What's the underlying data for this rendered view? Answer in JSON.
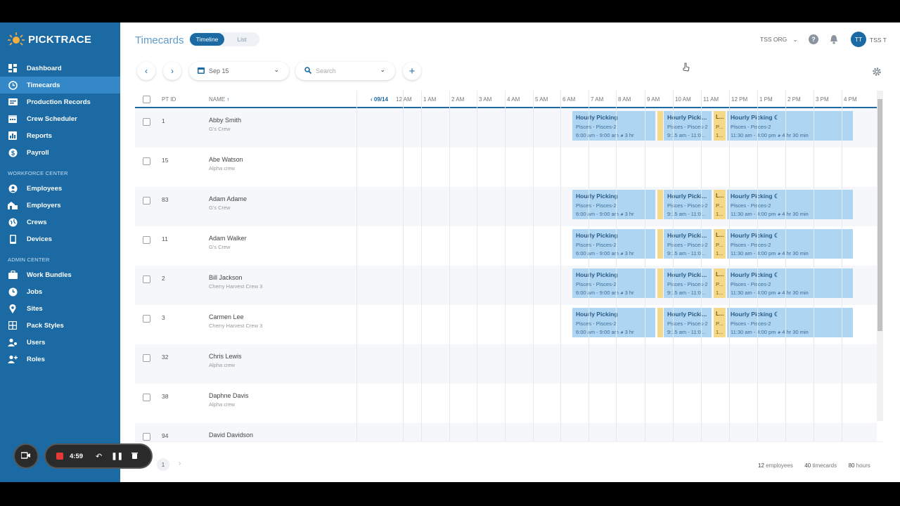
{
  "app": {
    "logo_text": "PICKTRACE"
  },
  "sidebar": {
    "items": [
      {
        "label": "Dashboard",
        "icon": "dashboard-icon"
      },
      {
        "label": "Timecards",
        "icon": "timecards-icon"
      },
      {
        "label": "Production Records",
        "icon": "production-records-icon"
      },
      {
        "label": "Crew Scheduler",
        "icon": "calendar-icon"
      },
      {
        "label": "Reports",
        "icon": "reports-icon"
      },
      {
        "label": "Payroll",
        "icon": "dollar-icon"
      }
    ],
    "workforce_label": "WORKFORCE CENTER",
    "workforce_items": [
      {
        "label": "Employees",
        "icon": "person-icon"
      },
      {
        "label": "Employers",
        "icon": "buildings-icon"
      },
      {
        "label": "Crews",
        "icon": "globe-icon"
      },
      {
        "label": "Devices",
        "icon": "phone-icon"
      }
    ],
    "admin_label": "ADMIN CENTER",
    "admin_items": [
      {
        "label": "Work Bundles",
        "icon": "briefcase-icon"
      },
      {
        "label": "Jobs",
        "icon": "clock-icon"
      },
      {
        "label": "Sites",
        "icon": "map-pin-icon"
      },
      {
        "label": "Pack Styles",
        "icon": "grid-icon"
      },
      {
        "label": "Users",
        "icon": "users-icon"
      },
      {
        "label": "Roles",
        "icon": "roles-icon"
      }
    ]
  },
  "header": {
    "title": "Timecards",
    "view_timeline": "Timeline",
    "view_list": "List",
    "org": "TSS ORG",
    "avatar_initials": "TT",
    "user": "TSS T"
  },
  "toolbar": {
    "date": "Sep 15",
    "search_placeholder": "Search"
  },
  "table": {
    "col_id": "PT ID",
    "col_name": "NAME",
    "prev_date": "09/14",
    "hours": [
      "12 AM",
      "1 AM",
      "2 AM",
      "3 AM",
      "4 AM",
      "5 AM",
      "6 AM",
      "7 AM",
      "8 AM",
      "9 AM",
      "10 AM",
      "11 AM",
      "12 PM",
      "1 PM",
      "2 PM",
      "3 PM",
      "4 PM"
    ],
    "rows": [
      {
        "id": "1",
        "name": "Abby Smith",
        "crew": "G's Crew",
        "has_blocks": true
      },
      {
        "id": "15",
        "name": "Abe Watson",
        "crew": "Alpha crew",
        "has_blocks": false
      },
      {
        "id": "83",
        "name": "Adam Adame",
        "crew": "G's Crew",
        "has_blocks": true
      },
      {
        "id": "11",
        "name": "Adam Walker",
        "crew": "G's Crew",
        "has_blocks": true
      },
      {
        "id": "2",
        "name": "Bill Jackson",
        "crew": "Cherry Harvest Crew 3",
        "has_blocks": true
      },
      {
        "id": "3",
        "name": "Carmen Lee",
        "crew": "Cherry Harvest Crew 3",
        "has_blocks": true
      },
      {
        "id": "32",
        "name": "Chris Lewis",
        "crew": "Alpha crew",
        "has_blocks": false
      },
      {
        "id": "38",
        "name": "Daphne Davis",
        "crew": "Alpha crew",
        "has_blocks": false
      },
      {
        "id": "94",
        "name": "David Davidson",
        "crew": "",
        "has_blocks": false
      }
    ],
    "block1": {
      "title": "Hourly Picking",
      "site": "Pisces - Pisces-2",
      "time": "6:00 am - 9:00 am",
      "dur": "3 hr"
    },
    "block2": {
      "title": "Hourly Picki...",
      "site": "Pisces - Pisces-2",
      "time": "9:15 am - 11:0..."
    },
    "block3": {
      "title": "L...",
      "site": "P...",
      "time": "1..."
    },
    "block4": {
      "title": "Hourly Picking",
      "site": "Pisces - Pisces-2",
      "time": "11:30 am - 4:00 pm",
      "dur": "4 hr 30 min"
    }
  },
  "footer": {
    "page": "1",
    "employees_count": "12",
    "employees_label": "employees",
    "timecards_count": "40",
    "timecards_label": "timecards",
    "hours_count": "80",
    "hours_label": "hours"
  },
  "recorder": {
    "time": "4:59"
  },
  "colors": {
    "brand": "#1b6aa3",
    "block_blue": "#aed5f2",
    "block_yellow": "#f5d98a"
  }
}
